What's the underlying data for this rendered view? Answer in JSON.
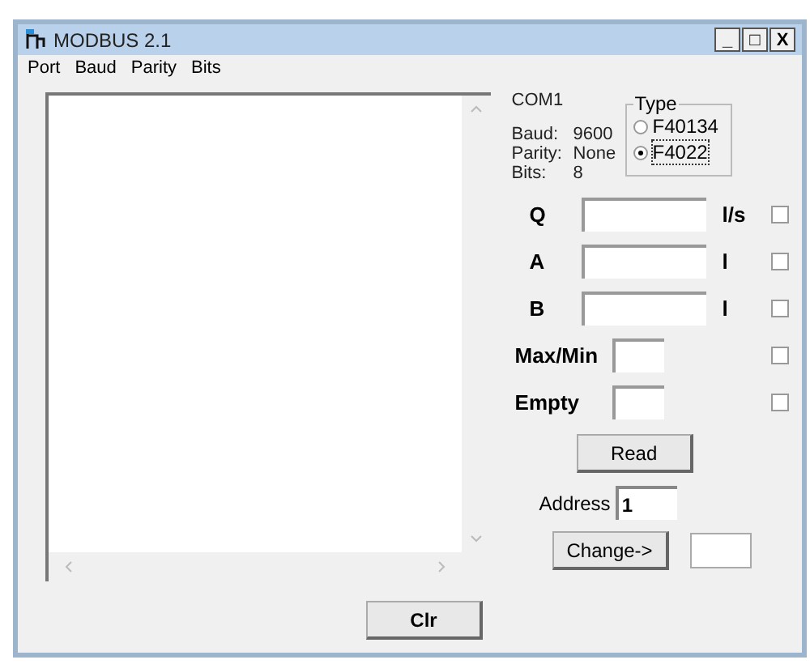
{
  "window": {
    "title": "MODBUS 2.1",
    "controls": [
      "_",
      "□",
      "X"
    ]
  },
  "menu": [
    "Port",
    "Baud",
    "Parity",
    "Bits"
  ],
  "status": {
    "port": "COM1",
    "rows": [
      {
        "label": "Baud:",
        "value": "9600"
      },
      {
        "label": "Parity:",
        "value": "None"
      },
      {
        "label": "Bits:",
        "value": "8"
      }
    ]
  },
  "type_group": {
    "title": "Type",
    "options": [
      {
        "label": "F40134",
        "selected": false
      },
      {
        "label": "F4022",
        "selected": true
      }
    ]
  },
  "fields": [
    {
      "label": "Q",
      "unit": "l/s",
      "checked": false,
      "kind": "wide"
    },
    {
      "label": "A",
      "unit": "l",
      "checked": false,
      "kind": "wide"
    },
    {
      "label": "B",
      "unit": "l",
      "checked": false,
      "kind": "wide"
    },
    {
      "label": "Max/Min",
      "checked": false,
      "kind": "narrow"
    },
    {
      "label": "Empty",
      "checked": false,
      "kind": "narrow"
    }
  ],
  "read_button": "Read",
  "address": {
    "label": "Address",
    "value": "1"
  },
  "change": {
    "button": "Change->"
  },
  "clear_button": "Clr"
}
